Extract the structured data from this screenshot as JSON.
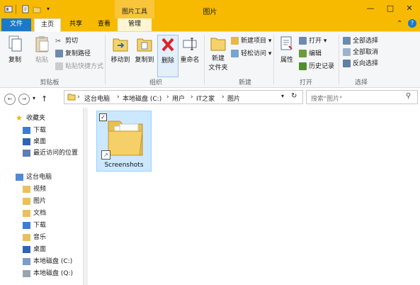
{
  "window": {
    "title": "图片",
    "context_group": "图片工具"
  },
  "tabs": {
    "file": "文件",
    "main": "主页",
    "share": "共享",
    "view": "查看",
    "manage": "管理"
  },
  "ribbon": {
    "clipboard": {
      "label": "剪贴板",
      "copy": "复制",
      "paste": "粘贴",
      "cut": "剪切",
      "copy_path": "复制路径",
      "paste_shortcut": "粘贴快捷方式"
    },
    "organize": {
      "label": "组织",
      "move_to": "移动到",
      "copy_to": "复制到",
      "delete": "删除",
      "rename": "重命名"
    },
    "new": {
      "label": "新建",
      "new_folder_line1": "新建",
      "new_folder_line2": "文件夹",
      "new_item": "新建项目",
      "easy_access": "轻松访问"
    },
    "open": {
      "label": "打开",
      "properties": "属性",
      "open": "打开",
      "edit": "编辑",
      "history": "历史记录"
    },
    "select": {
      "label": "选择",
      "select_all": "全部选择",
      "select_none": "全部取消",
      "invert": "反向选择"
    }
  },
  "address": {
    "crumbs": [
      "这台电脑",
      "本地磁盘 (C:)",
      "用户",
      "IT之家",
      "图片"
    ],
    "search_placeholder": "搜索\"图片\""
  },
  "navpane": {
    "favorites": "收藏夹",
    "downloads": "下载",
    "desktop": "桌面",
    "recent": "最近访问的位置",
    "this_pc": "这台电脑",
    "videos": "视频",
    "pictures": "图片",
    "documents": "文档",
    "pc_downloads": "下载",
    "music": "音乐",
    "pc_desktop": "桌面",
    "drive_c": "本地磁盘 (C:)",
    "drive_q": "本地磁盘 (Q:)"
  },
  "content": {
    "items": [
      {
        "name": "Screenshots",
        "selected": true
      }
    ]
  },
  "colors": {
    "title_bar": "#f7ba00",
    "file_tab": "#1979ca",
    "selection": "#cce8ff"
  }
}
